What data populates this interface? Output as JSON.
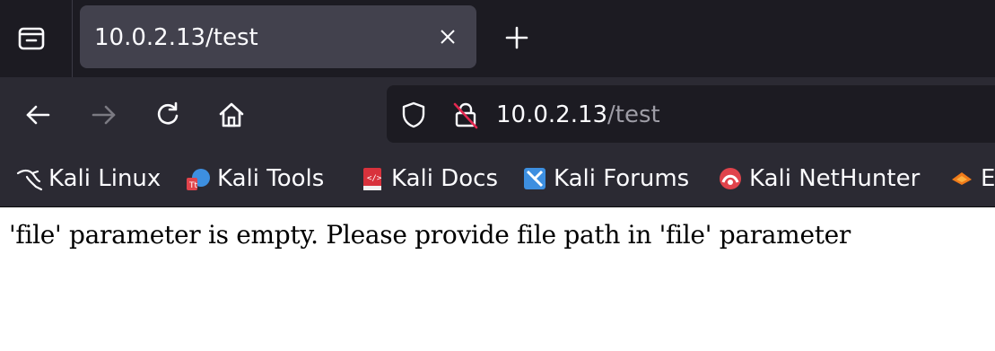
{
  "tab": {
    "title": "10.0.2.13/test"
  },
  "urlbar": {
    "host": "10.0.2.13",
    "path": "/test"
  },
  "bookmarks": [
    {
      "label": "Kali Linux",
      "icon": "kali-dragon-icon"
    },
    {
      "label": "Kali Tools",
      "icon": "kali-tools-icon"
    },
    {
      "label": "Kali Docs",
      "icon": "kali-docs-icon"
    },
    {
      "label": "Kali Forums",
      "icon": "kali-forums-icon"
    },
    {
      "label": "Kali NetHunter",
      "icon": "kali-nethunter-icon"
    },
    {
      "label": "E",
      "icon": "exploit-db-icon"
    }
  ],
  "page": {
    "message": "'file' parameter is empty. Please provide file path in 'file' parameter"
  },
  "colors": {
    "tabstrip": "#1c1b22",
    "toolbar": "#2b2a33",
    "active_tab": "#42414d",
    "text_light": "#fbfbfe"
  }
}
